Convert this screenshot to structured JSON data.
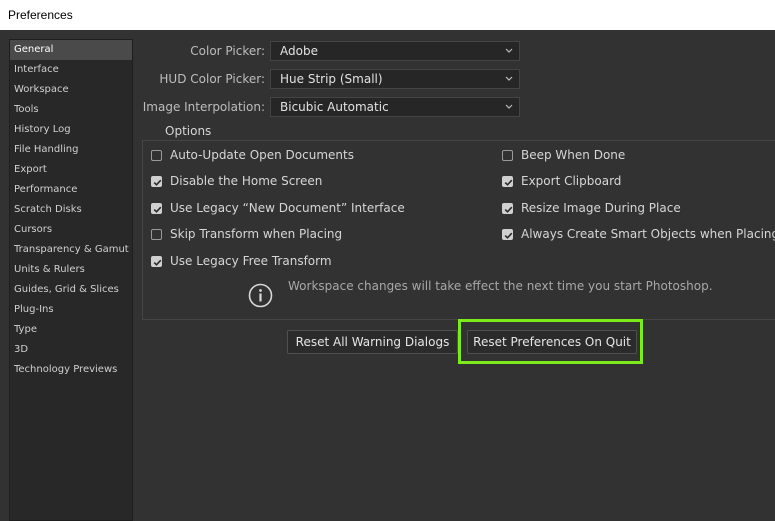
{
  "window": {
    "title": "Preferences"
  },
  "sidebar": {
    "items": [
      {
        "label": "General",
        "active": true
      },
      {
        "label": "Interface"
      },
      {
        "label": "Workspace"
      },
      {
        "label": "Tools"
      },
      {
        "label": "History Log"
      },
      {
        "label": "File Handling"
      },
      {
        "label": "Export"
      },
      {
        "label": "Performance"
      },
      {
        "label": "Scratch Disks"
      },
      {
        "label": "Cursors"
      },
      {
        "label": "Transparency & Gamut"
      },
      {
        "label": "Units & Rulers"
      },
      {
        "label": "Guides, Grid & Slices"
      },
      {
        "label": "Plug-Ins"
      },
      {
        "label": "Type"
      },
      {
        "label": "3D"
      },
      {
        "label": "Technology Previews"
      }
    ]
  },
  "general": {
    "color_picker": {
      "label": "Color Picker:",
      "value": "Adobe"
    },
    "hud_color_picker": {
      "label": "HUD Color Picker:",
      "value": "Hue Strip (Small)"
    },
    "image_interpolation": {
      "label": "Image Interpolation:",
      "value": "Bicubic Automatic"
    },
    "options": {
      "title": "Options",
      "left": [
        {
          "label": "Auto-Update Open Documents",
          "checked": false
        },
        {
          "label": "Disable the Home Screen",
          "checked": true
        },
        {
          "label": "Use Legacy “New Document” Interface",
          "checked": true
        },
        {
          "label": "Skip Transform when Placing",
          "checked": false
        },
        {
          "label": "Use Legacy Free Transform",
          "checked": true
        }
      ],
      "right": [
        {
          "label": "Beep When Done",
          "checked": false
        },
        {
          "label": "Export Clipboard",
          "checked": true
        },
        {
          "label": "Resize Image During Place",
          "checked": true
        },
        {
          "label": "Always Create Smart Objects when Placing",
          "checked": true
        }
      ]
    },
    "info_text": "Workspace changes will take effect the next time you start Photoshop.",
    "reset_warning_button": "Reset All Warning Dialogs",
    "reset_prefs_button": "Reset Preferences On Quit"
  },
  "colors": {
    "highlight": "#7dea1a",
    "background": "#323232"
  }
}
